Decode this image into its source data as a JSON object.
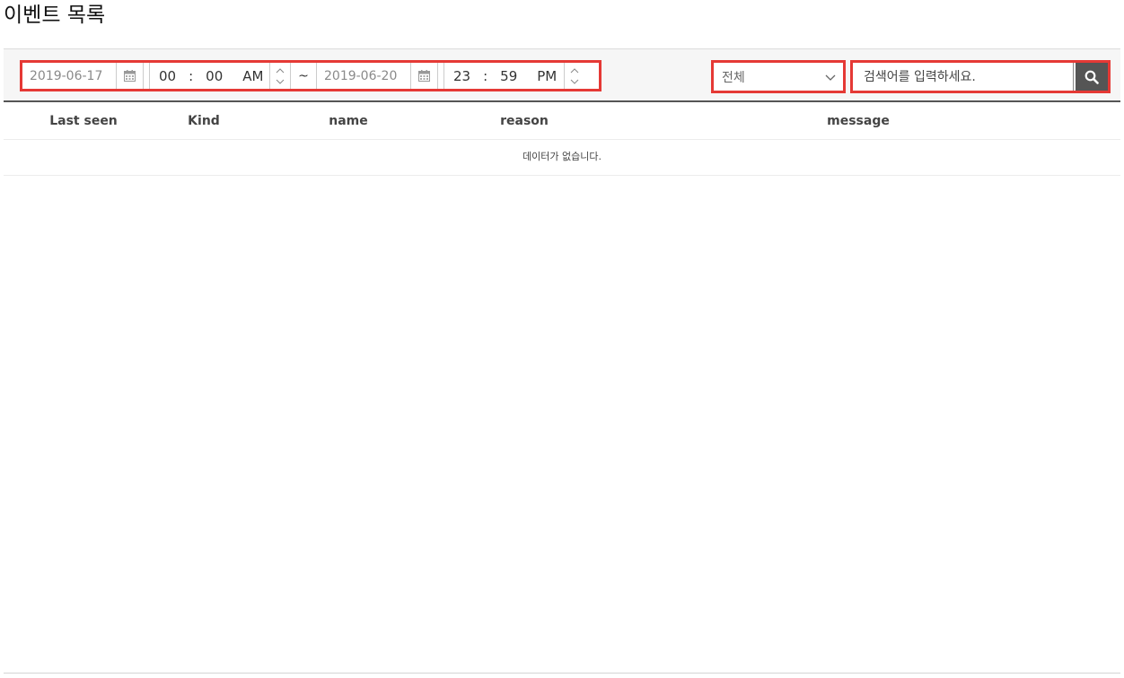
{
  "page": {
    "title": "이벤트 목록"
  },
  "filter": {
    "start_date": "2019-06-17",
    "start_time": {
      "hour": "00",
      "minute": "00",
      "ampm": "AM"
    },
    "range_separator": "~",
    "end_date": "2019-06-20",
    "end_time": {
      "hour": "23",
      "minute": "59",
      "ampm": "PM"
    },
    "kind_select": {
      "selected": "전체"
    },
    "search": {
      "placeholder": "검색어를 입력하세요.",
      "value": ""
    }
  },
  "table": {
    "columns": [
      "Last seen",
      "Kind",
      "name",
      "reason",
      "message"
    ],
    "rows": [],
    "empty_message": "데이터가 없습니다."
  },
  "icons": {
    "calendar": "calendar-icon",
    "spin_up": "chevron-up-icon",
    "spin_down": "chevron-down-icon",
    "dropdown": "chevron-down-icon",
    "search": "search-icon"
  },
  "colors": {
    "highlight_border": "#e53935",
    "search_button": "#555555",
    "toolbar_background": "#f6f6f6"
  }
}
